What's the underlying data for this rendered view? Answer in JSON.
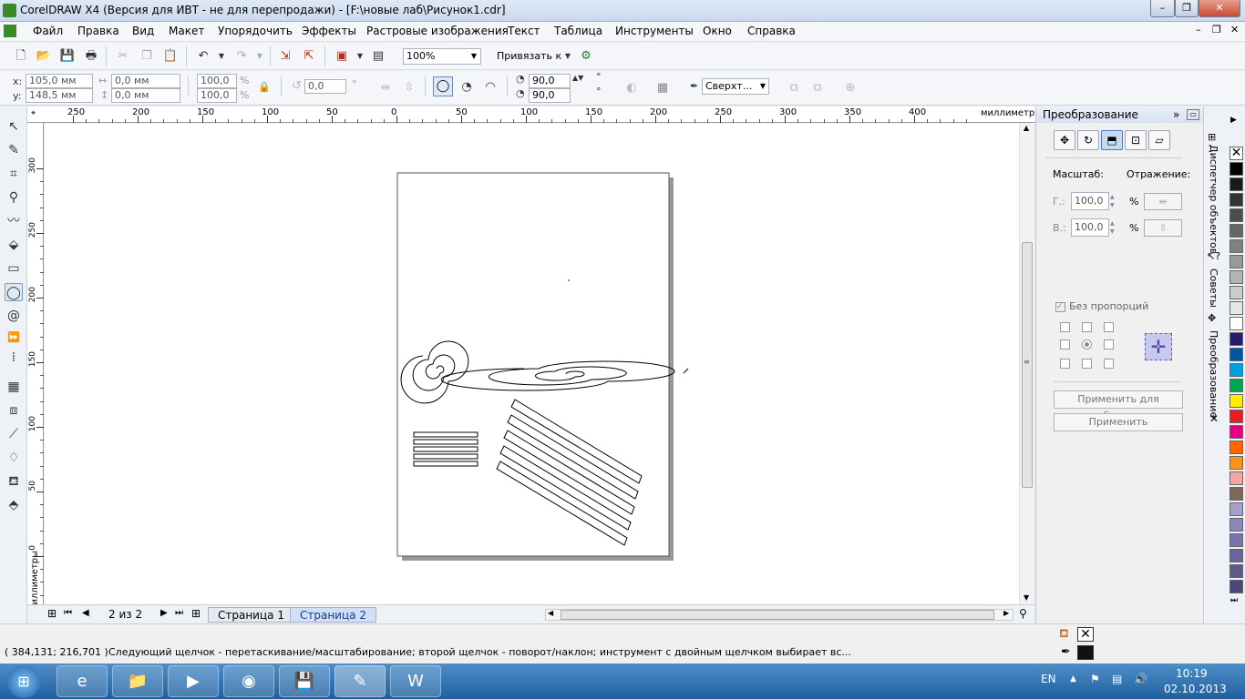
{
  "window": {
    "title": "CorelDRAW X4 (Версия для ИВТ - не для перепродажи) - [F:\\новые лаб\\Рисунок1.cdr]",
    "minimize": "–",
    "maximize": "❐",
    "close": "✕"
  },
  "menu": [
    "Файл",
    "Правка",
    "Вид",
    "Макет",
    "Упорядочить",
    "Эффекты",
    "Растровые изображения",
    "Текст",
    "Таблица",
    "Инструменты",
    "Окно",
    "Справка"
  ],
  "toolbar": {
    "zoom": "100%",
    "snap": "Привязать к"
  },
  "propbar": {
    "x_label": "x:",
    "x_value": "105,0 мм",
    "y_label": "y:",
    "y_value": "148,5 мм",
    "w_value": "0,0 мм",
    "h_value": "0,0 мм",
    "scale_w": "100,0",
    "scale_h": "100,0",
    "percent": "%",
    "rotation": "0,0",
    "degree": "°",
    "start_angle": "90,0",
    "end_angle": "90,0",
    "outline": "Сверхт..."
  },
  "ruler": {
    "h_ticks": [
      "250",
      "200",
      "150",
      "100",
      "50",
      "0",
      "50",
      "100",
      "150",
      "200",
      "250",
      "300",
      "350",
      "400"
    ],
    "h_unit": "миллиметры",
    "v_ticks": [
      "300",
      "250",
      "200",
      "150",
      "100",
      "50",
      "0"
    ],
    "v_unit": "миллиметры"
  },
  "pages": {
    "counter": "2 из 2",
    "tabs": [
      "Страница 1",
      "Страница 2"
    ]
  },
  "docker": {
    "title": "Преобразование",
    "scale_label": "Масштаб:",
    "mirror_label": "Отражение:",
    "h_label": "Г.:",
    "h_value": "100,0",
    "v_label": "В.:",
    "v_value": "100,0",
    "percent": "%",
    "no_proportions": "Без пропорций",
    "apply_dup": "Применить для дубликата",
    "apply": "Применить"
  },
  "side_tabs": [
    "Диспетчер объектов",
    "Советы",
    "Преобразование"
  ],
  "palette_colors": [
    "#000000",
    "#1a1a1a",
    "#333333",
    "#4d4d4d",
    "#666666",
    "#808080",
    "#999999",
    "#b3b3b3",
    "#cccccc",
    "#e6e6e6",
    "#ffffff",
    "#2d1a6e",
    "#0055a5",
    "#00a0e0",
    "#00a651",
    "#ffec00",
    "#e31e24",
    "#e6007e",
    "#ff6600",
    "#f7941d",
    "#f4a6a6",
    "#7a6a55",
    "#a8a0c8",
    "#8d86b8",
    "#7a72a8",
    "#6c6498",
    "#5f5a88",
    "#4b4778"
  ],
  "status": {
    "coords": "( 384,131; 216,701 )",
    "message": "Следующий щелчок - перетаскивание/масштабирование; второй щелчок - поворот/наклон; инструмент с двойным щелчком выбирает вс..."
  },
  "taskbar": {
    "lang": "EN",
    "time": "10:19",
    "date": "02.10.2013"
  }
}
